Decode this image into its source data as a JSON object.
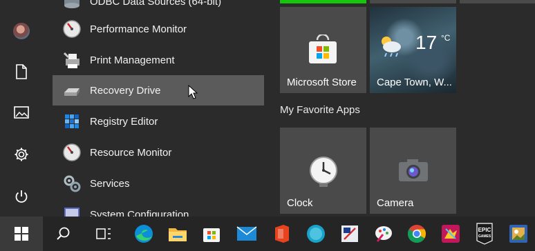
{
  "app_list": {
    "items": [
      {
        "label": "ODBC Data Sources (64-bit)",
        "icon": "odbc-icon"
      },
      {
        "label": "Performance Monitor",
        "icon": "performance-monitor-icon"
      },
      {
        "label": "Print Management",
        "icon": "print-management-icon"
      },
      {
        "label": "Recovery Drive",
        "icon": "recovery-drive-icon"
      },
      {
        "label": "Registry Editor",
        "icon": "registry-editor-icon"
      },
      {
        "label": "Resource Monitor",
        "icon": "resource-monitor-icon"
      },
      {
        "label": "Services",
        "icon": "services-icon"
      },
      {
        "label": "System Configuration",
        "icon": "system-configuration-icon"
      }
    ],
    "hovered": "Recovery Drive"
  },
  "tiles": {
    "group_label": "My Favorite Apps",
    "microsoft_store": {
      "label": "Microsoft Store"
    },
    "weather": {
      "label": "Cape Town, W...",
      "temperature": "17",
      "unit": "°C"
    },
    "clock": {
      "label": "Clock"
    },
    "camera": {
      "label": "Camera"
    }
  },
  "colors": {
    "accent_green": "#16c60c",
    "hover_bg": "#5b5b5b",
    "tile_bg": "#4a4a4a",
    "panel_bg": "#2b2b2b",
    "taskbar_bg": "#252525"
  },
  "taskbar": {
    "pinned": [
      "edge-icon",
      "file-explorer-icon",
      "microsoft-store-icon",
      "mail-icon",
      "office-icon",
      "cortana-icon",
      "snipping-tool-icon",
      "paint-icon",
      "chrome-icon",
      "game-icon",
      "epic-games-icon",
      "photos-icon"
    ],
    "epic_text": "EPIC\nGAMES"
  }
}
